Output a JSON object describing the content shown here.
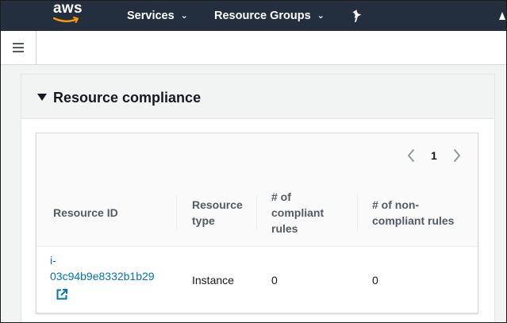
{
  "topnav": {
    "logo_text": "aws",
    "services_label": "Services",
    "resource_groups_label": "Resource Groups",
    "pin_icon": "pin-icon",
    "chevron_icon": "chevron-down-icon",
    "background": "#232f3e",
    "logo_accent": "#ff9900"
  },
  "subbar": {
    "menu_icon": "hamburger-menu-icon"
  },
  "panel": {
    "title": "Resource compliance",
    "collapse_icon": "caret-down-icon"
  },
  "pagination": {
    "prev_icon": "chevron-left-icon",
    "current_page": "1",
    "next_icon": "chevron-right-icon"
  },
  "table": {
    "headers": {
      "resource_id": "Resource ID",
      "resource_type_line1": "Resource",
      "resource_type_line2": "type",
      "compliant_line1": "# of",
      "compliant_line2": "compliant",
      "compliant_line3": "rules",
      "noncompliant_line1": "# of non-",
      "noncompliant_line2": "compliant rules"
    },
    "rows": [
      {
        "resource_id_line1": "i-",
        "resource_id_line2": "03c94b9e8332b1b29",
        "resource_type": "Instance",
        "compliant_rules": "0",
        "noncompliant_rules": "0",
        "link_icon": "external-link-icon"
      }
    ],
    "link_color": "#0073bb"
  }
}
